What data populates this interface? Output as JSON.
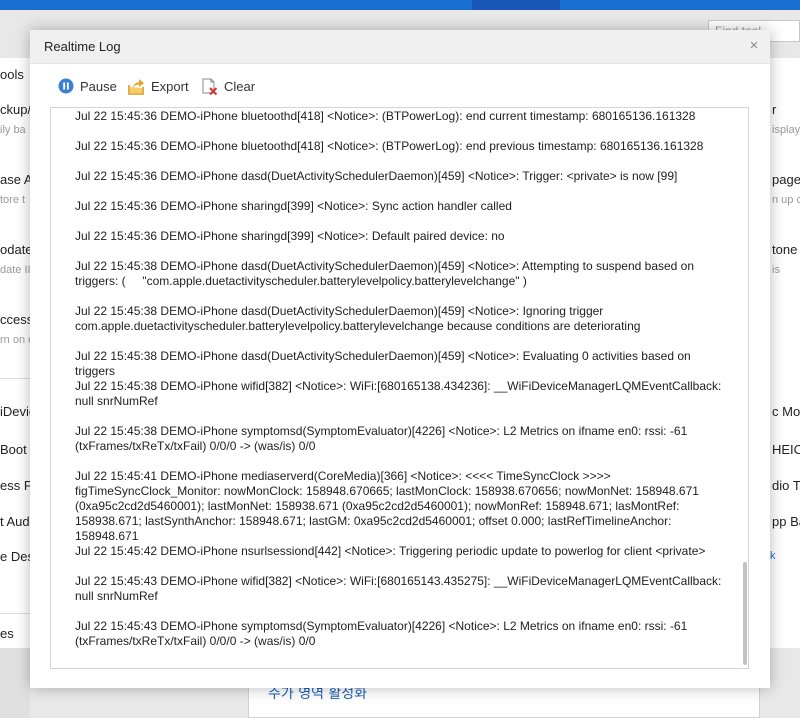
{
  "background": {
    "search_placeholder": "Find tool",
    "left_items": [
      {
        "label": "ools",
        "sub": ""
      },
      {
        "label": "ckup/",
        "sub": "ily ba"
      },
      {
        "label": "ase A",
        "sub": "tore t"
      },
      {
        "label": "odate",
        "sub": "date II"
      },
      {
        "label": "ccessib",
        "sub": "rn on c"
      },
      {
        "label": "iDevic",
        "sub": ""
      },
      {
        "label": "Boot",
        "sub": ""
      },
      {
        "label": "ess Ph",
        "sub": ""
      },
      {
        "label": "t Audi",
        "sub": ""
      },
      {
        "label": "e Desc",
        "sub": ""
      },
      {
        "label": "es",
        "sub": ""
      }
    ],
    "right_items": [
      {
        "label": "r",
        "sub": "isplay"
      },
      {
        "label": "page",
        "sub": "n up c"
      },
      {
        "label": "tone",
        "sub": "is"
      },
      {
        "label": "c Mo",
        "sub": ""
      },
      {
        "label": "HEIC",
        "sub": ""
      },
      {
        "label": "dio Tag",
        "sub": ""
      },
      {
        "label": "pp Ba",
        "sub": ""
      }
    ],
    "right_link": "k",
    "bottom_korean": "주가 영역 활성화"
  },
  "dialog": {
    "title": "Realtime Log",
    "close_symbol": "×",
    "toolbar": {
      "pause_label": "Pause",
      "export_label": "Export",
      "clear_label": "Clear"
    },
    "colors": {
      "pause_icon": "#3a7fd5",
      "export_icon": "#e2a62a",
      "clear_icon": "#d33333"
    },
    "log_entries": [
      "Jul 22 15:45:36 DEMO-iPhone bluetoothd[418] <Notice>: (BTPowerLog): end current timestamp: 680165136.161328",
      "Jul 22 15:45:36 DEMO-iPhone bluetoothd[418] <Notice>: (BTPowerLog): end previous timestamp: 680165136.161328",
      "Jul 22 15:45:36 DEMO-iPhone dasd(DuetActivitySchedulerDaemon)[459] <Notice>: Trigger: <private> is now [99]",
      "Jul 22 15:45:36 DEMO-iPhone sharingd[399] <Notice>: Sync action handler called",
      "Jul 22 15:45:36 DEMO-iPhone sharingd[399] <Notice>: Default paired device: no",
      "Jul 22 15:45:38 DEMO-iPhone dasd(DuetActivitySchedulerDaemon)[459] <Notice>: Attempting to suspend based on triggers: (     \"com.apple.duetactivityscheduler.batterylevelpolicy.batterylevelchange\" )",
      "Jul 22 15:45:38 DEMO-iPhone dasd(DuetActivitySchedulerDaemon)[459] <Notice>: Ignoring trigger com.apple.duetactivityscheduler.batterylevelpolicy.batterylevelchange because conditions are deteriorating",
      "Jul 22 15:45:38 DEMO-iPhone dasd(DuetActivitySchedulerDaemon)[459] <Notice>: Evaluating 0 activities based on triggers",
      "Jul 22 15:45:38 DEMO-iPhone wifid[382] <Notice>: WiFi:[680165138.434236]: __WiFiDeviceManagerLQMEventCallback: null snrNumRef",
      "Jul 22 15:45:38 DEMO-iPhone symptomsd(SymptomEvaluator)[4226] <Notice>: L2 Metrics on ifname en0: rssi: -61 (txFrames/txReTx/txFail) 0/0/0 -> (was/is) 0/0",
      "Jul 22 15:45:41 DEMO-iPhone mediaserverd(CoreMedia)[366] <Notice>: <<<< TimeSyncClock >>>> figTimeSyncClock_Monitor: nowMonClock: 158948.670665; lastMonClock: 158938.670656; nowMonNet: 158948.671 (0xa95c2cd2d5460001); lastMonNet: 158938.671 (0xa95c2cd2d5460001); nowMonRef: 158948.671; lasMontRef: 158938.671; lastSynthAnchor: 158948.671; lastGM: 0xa95c2cd2d5460001; offset 0.000; lastRefTimelineAnchor: 158948.671",
      "Jul 22 15:45:42 DEMO-iPhone nsurlsessiond[442] <Notice>: Triggering periodic update to powerlog for client <private>",
      "Jul 22 15:45:43 DEMO-iPhone wifid[382] <Notice>: WiFi:[680165143.435275]: __WiFiDeviceManagerLQMEventCallback: null snrNumRef",
      "Jul 22 15:45:43 DEMO-iPhone symptomsd(SymptomEvaluator)[4226] <Notice>: L2 Metrics on ifname en0: rssi: -61 (txFrames/txReTx/txFail) 0/0/0 -> (was/is) 0/0"
    ]
  }
}
